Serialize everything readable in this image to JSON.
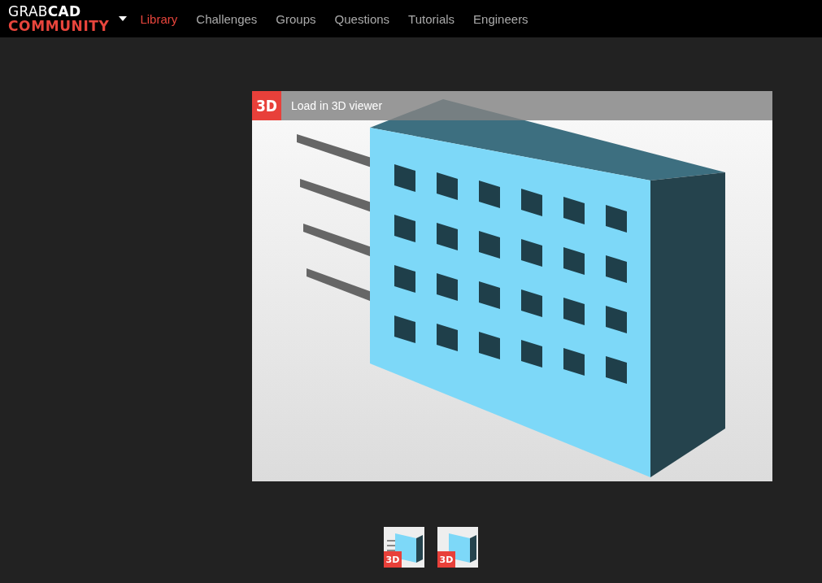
{
  "brand": {
    "name": "GRAB**CAD**",
    "tagline": "COMMUNITY"
  },
  "nav": [
    {
      "label": "Library",
      "selected": true
    },
    {
      "label": "Challenges",
      "selected": false
    },
    {
      "label": "Groups",
      "selected": false
    },
    {
      "label": "Questions",
      "selected": false
    },
    {
      "label": "Tutorials",
      "selected": false
    },
    {
      "label": "Engineers",
      "selected": false
    }
  ],
  "viewer": {
    "badge": "3D",
    "label": "Load in 3D viewer"
  },
  "thumbnails": [
    {
      "badge": "3D",
      "pins": true
    },
    {
      "badge": "3D",
      "pins": false
    }
  ]
}
